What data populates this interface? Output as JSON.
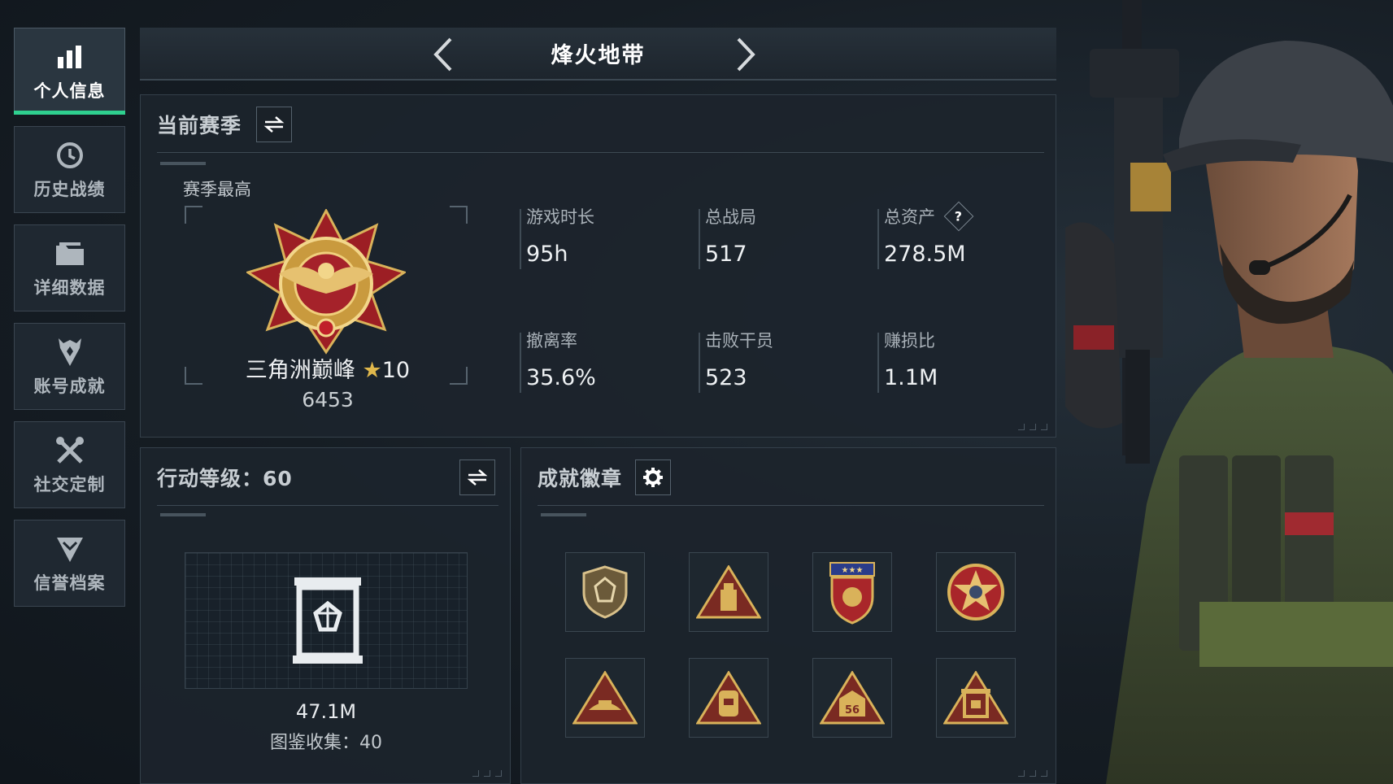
{
  "sidebar": {
    "items": [
      {
        "label": "个人信息",
        "icon": "bar-chart-icon",
        "active": true
      },
      {
        "label": "历史战绩",
        "icon": "clock-icon",
        "active": false
      },
      {
        "label": "详细数据",
        "icon": "folder-icon",
        "active": false
      },
      {
        "label": "账号成就",
        "icon": "achievement-icon",
        "active": false
      },
      {
        "label": "社交定制",
        "icon": "tools-icon",
        "active": false
      },
      {
        "label": "信誉档案",
        "icon": "credit-shield-icon",
        "active": false
      }
    ]
  },
  "header": {
    "title": "烽火地带"
  },
  "season": {
    "title": "当前赛季",
    "best_label": "赛季最高",
    "rank_name": "三角洲巅峰",
    "rank_star": "★",
    "rank_level": "10",
    "rank_points": "6453",
    "stats": [
      {
        "label": "游戏时长",
        "value": "95h"
      },
      {
        "label": "总战局",
        "value": "517"
      },
      {
        "label": "总资产",
        "value": "278.5M",
        "help": "?"
      },
      {
        "label": "撤离率",
        "value": "35.6%"
      },
      {
        "label": "击败干员",
        "value": "523"
      },
      {
        "label": "赚损比",
        "value": "1.1M"
      }
    ]
  },
  "level": {
    "title": "行动等级：60",
    "value": "47.1M",
    "collection": "图鉴收集：40"
  },
  "achievements": {
    "title": "成就徽章",
    "badge_labels": [
      "56"
    ]
  },
  "colors": {
    "accent": "#2fd08f",
    "gold": "#e0b84c",
    "medal_red": "#b3222a"
  }
}
